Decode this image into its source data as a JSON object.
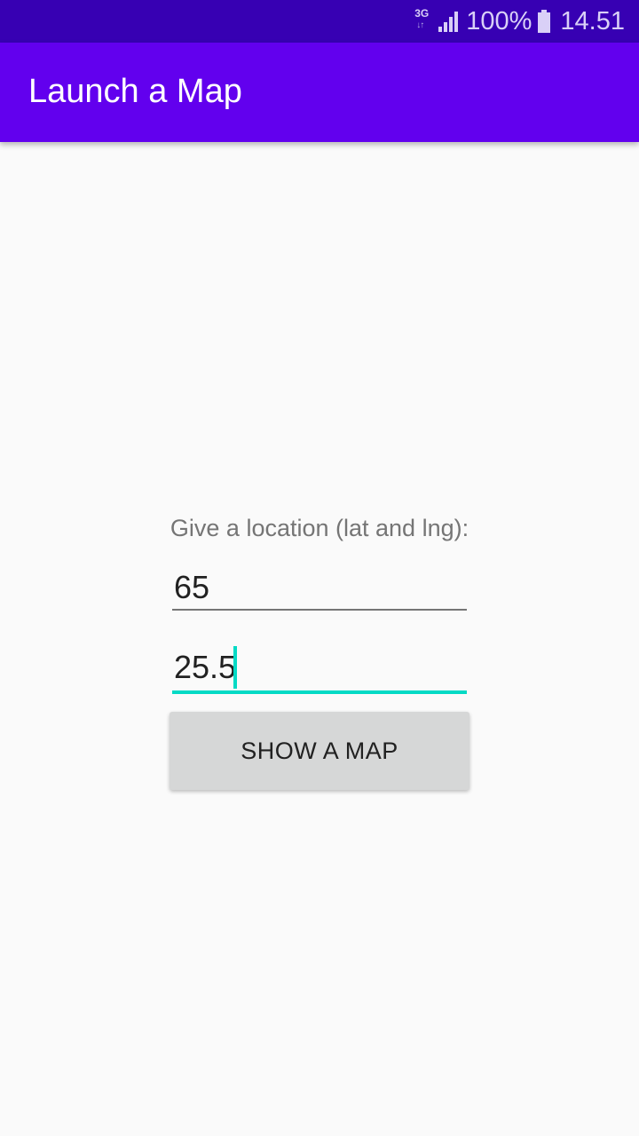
{
  "status_bar": {
    "network_type": "3G",
    "battery_percent": "100%",
    "time": "14.51",
    "icons": [
      "network-3g-icon",
      "signal-icon",
      "battery-icon"
    ]
  },
  "app_bar": {
    "title": "Launch a Map",
    "color": "#6200ee"
  },
  "form": {
    "prompt": "Give a location (lat and lng):",
    "lat_value": "65",
    "lng_value": "25.5",
    "show_map_label": "SHOW A MAP",
    "accent_color": "#03dac5"
  }
}
